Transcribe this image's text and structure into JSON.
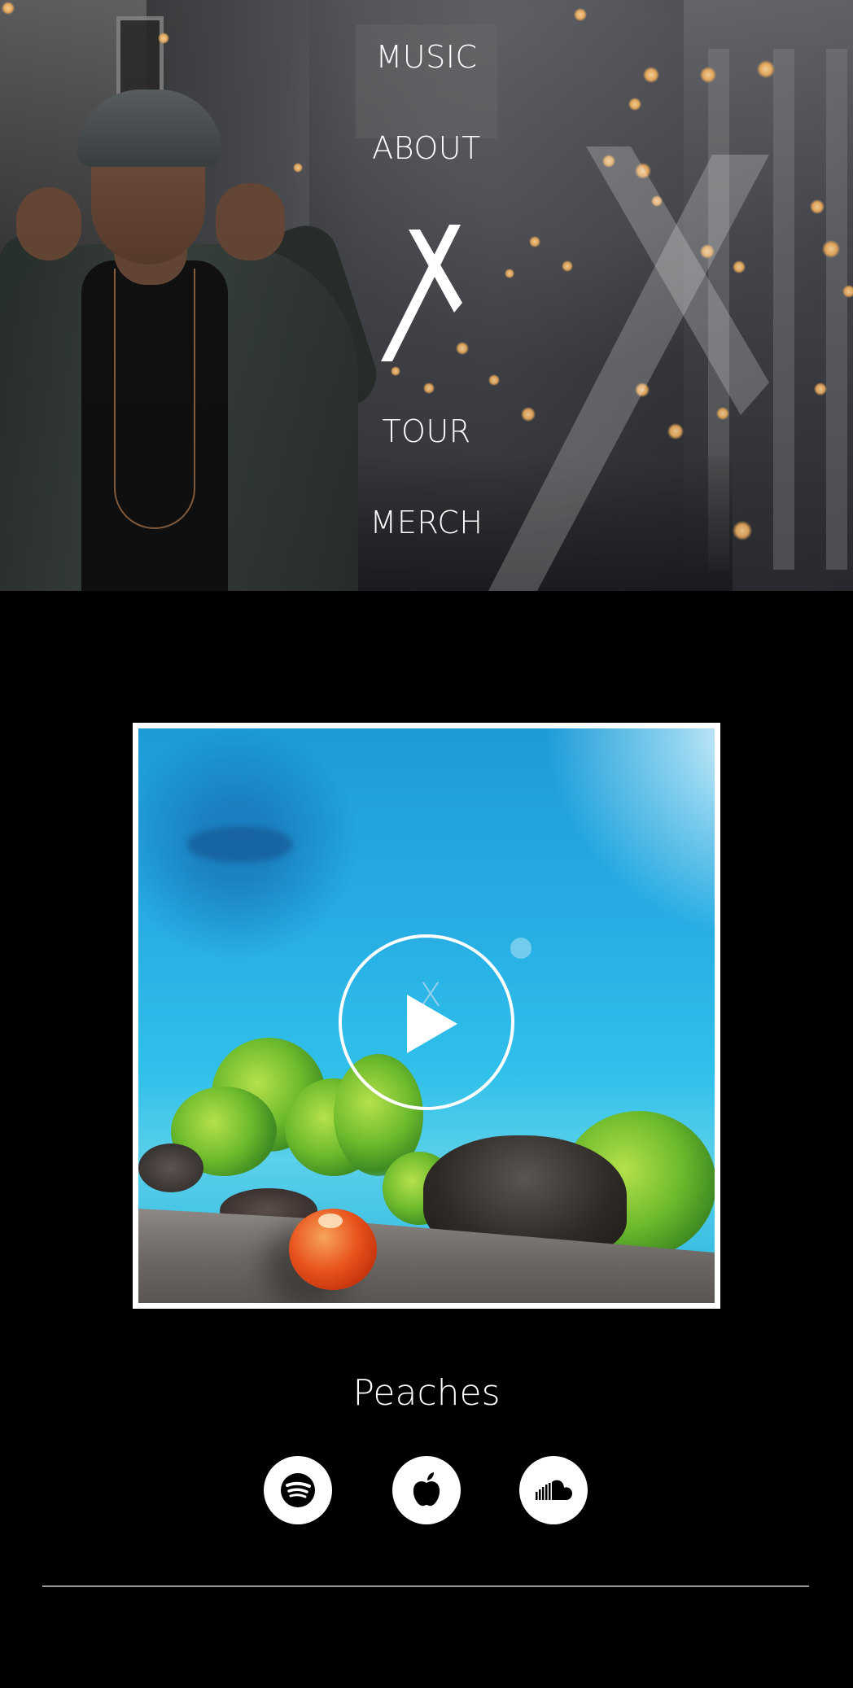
{
  "nav": {
    "items": [
      {
        "label": "MUSIC"
      },
      {
        "label": "ABOUT"
      },
      {
        "label": "TOUR"
      },
      {
        "label": "MERCH"
      }
    ],
    "logo_icon": "x-logo-icon"
  },
  "player": {
    "cover_icon": "album-cover",
    "play_icon": "play-icon",
    "song_title": "Peaches"
  },
  "streaming": {
    "items": [
      {
        "service": "Spotify",
        "icon": "spotify-icon"
      },
      {
        "service": "Apple Music",
        "icon": "apple-icon"
      },
      {
        "service": "SoundCloud",
        "icon": "soundcloud-icon"
      }
    ]
  },
  "colors": {
    "background": "#000000",
    "text": "#ffffff",
    "divider": "#9a9a9a"
  }
}
